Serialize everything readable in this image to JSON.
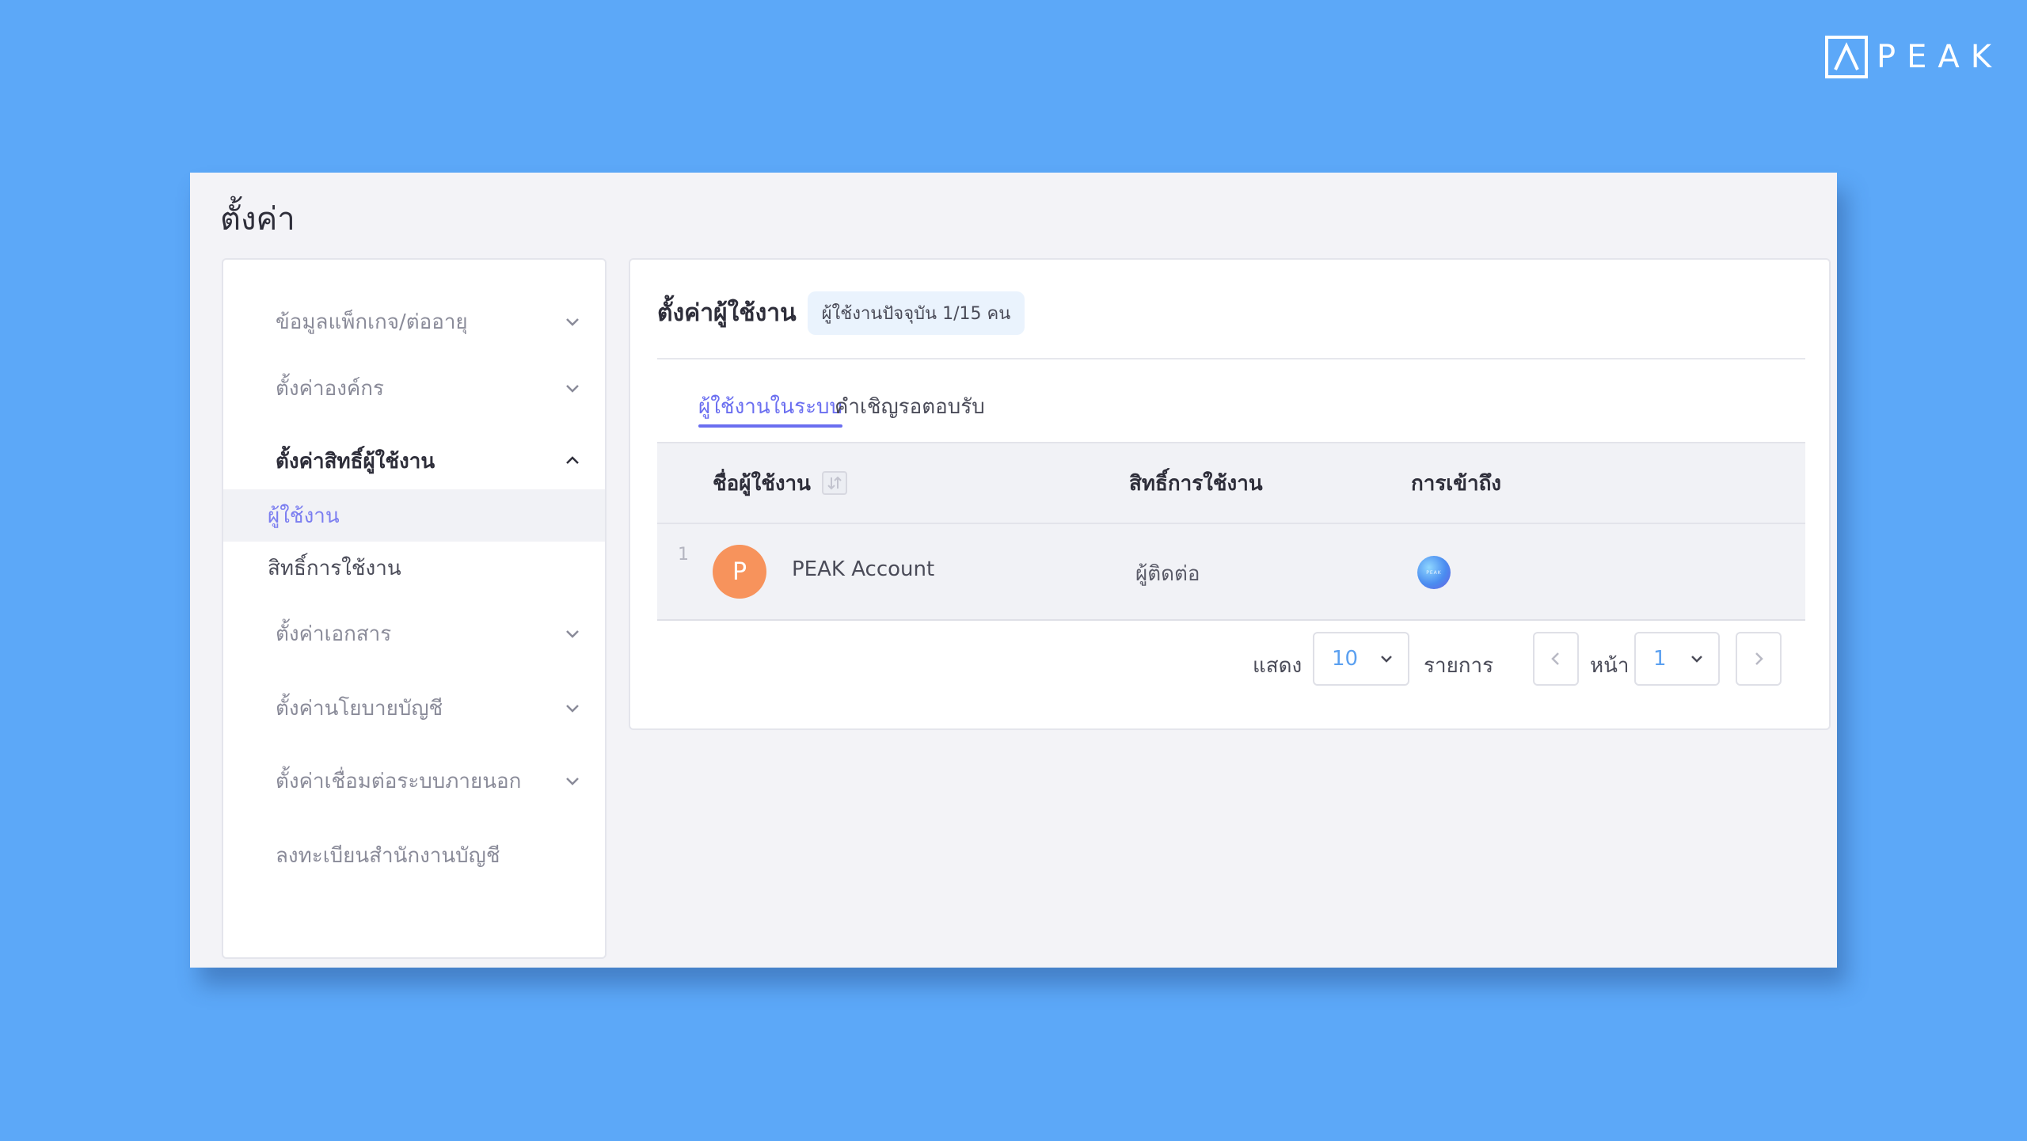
{
  "brand": {
    "logo_text": "PEAK"
  },
  "page": {
    "title": "ตั้งค่า"
  },
  "sidebar": {
    "items": [
      {
        "label": "ข้อมูลแพ็กเกจ/ต่ออายุ",
        "icon": "chevron-down-icon"
      },
      {
        "label": "ตั้งค่าองค์กร",
        "icon": "chevron-down-icon"
      },
      {
        "label": "ตั้งค่าสิทธิ์ผู้ใช้งาน",
        "icon": "chevron-up-icon",
        "expanded": true
      },
      {
        "label": "ตั้งค่าเอกสาร",
        "icon": "chevron-down-icon"
      },
      {
        "label": "ตั้งค่านโยบายบัญชี",
        "icon": "chevron-down-icon"
      },
      {
        "label": "ตั้งค่าเชื่อมต่อระบบภายนอก",
        "icon": "chevron-down-icon"
      },
      {
        "label": "ลงทะเบียนสำนักงานบัญชี"
      }
    ],
    "subitems": [
      {
        "label": "ผู้ใช้งาน",
        "active": true
      },
      {
        "label": "สิทธิ์การใช้งาน",
        "active": false
      }
    ]
  },
  "main": {
    "title": "ตั้งค่าผู้ใช้งาน",
    "badge": "ผู้ใช้งานปัจจุบัน 1/15 คน",
    "tabs": [
      {
        "label": "ผู้ใช้งานในระบบ",
        "active": true
      },
      {
        "label": "คำเชิญรอตอบรับ",
        "active": false
      }
    ],
    "table": {
      "columns": [
        "ชื่อผู้ใช้งาน",
        "สิทธิ์การใช้งาน",
        "การเข้าถึง"
      ],
      "rows": [
        {
          "index": "1",
          "avatar_letter": "P",
          "name": "PEAK Account",
          "role": "ผู้ติดต่อ",
          "access_icon": "peak-app-icon"
        }
      ]
    },
    "pagination": {
      "show_label": "แสดง",
      "page_size": "10",
      "items_label": "รายการ",
      "page_label": "หน้า",
      "page": "1"
    }
  },
  "colors": {
    "background": "#5ca8f8",
    "accent": "#6a6ef0",
    "avatar": "#f7935c",
    "select_value": "#5ba0f0"
  }
}
